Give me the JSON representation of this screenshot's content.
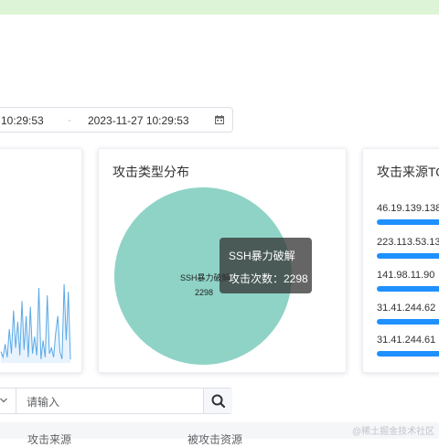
{
  "date_range": {
    "start": "10:29:53",
    "separator": "-",
    "end": "2023-11-27 10:29:53"
  },
  "trend_card": {
    "line_values": [
      6,
      3,
      10,
      3,
      18,
      5,
      28,
      8,
      22,
      4,
      33,
      7,
      25,
      3,
      30,
      5,
      14,
      4,
      40,
      2,
      12,
      3,
      36,
      5,
      8,
      3,
      16,
      25,
      6,
      2,
      42,
      12,
      38,
      2
    ]
  },
  "attack_type_card": {
    "title": "攻击类型分布",
    "chart_data": {
      "type": "pie",
      "slices": [
        {
          "name": "SSH暴力破解",
          "value": 2298,
          "color": "#8fd3c7"
        }
      ]
    },
    "slice_label": "SSH暴力破解",
    "slice_value": "2298",
    "tooltip": {
      "name": "SSH暴力破解",
      "count_line": "攻击次数：2298"
    }
  },
  "source_card": {
    "title": "攻击来源TO",
    "items": [
      {
        "ip": "46.19.139.138"
      },
      {
        "ip": "223.113.53.13"
      },
      {
        "ip": "141.98.11.90"
      },
      {
        "ip": "31.41.244.62"
      },
      {
        "ip": "31.41.244.61"
      }
    ],
    "bar_color": "#1e90ff"
  },
  "search": {
    "placeholder": "请输入"
  },
  "table": {
    "col1": "攻击来源",
    "col2": "被攻击资源"
  },
  "watermark": "@稀土掘金技术社区"
}
